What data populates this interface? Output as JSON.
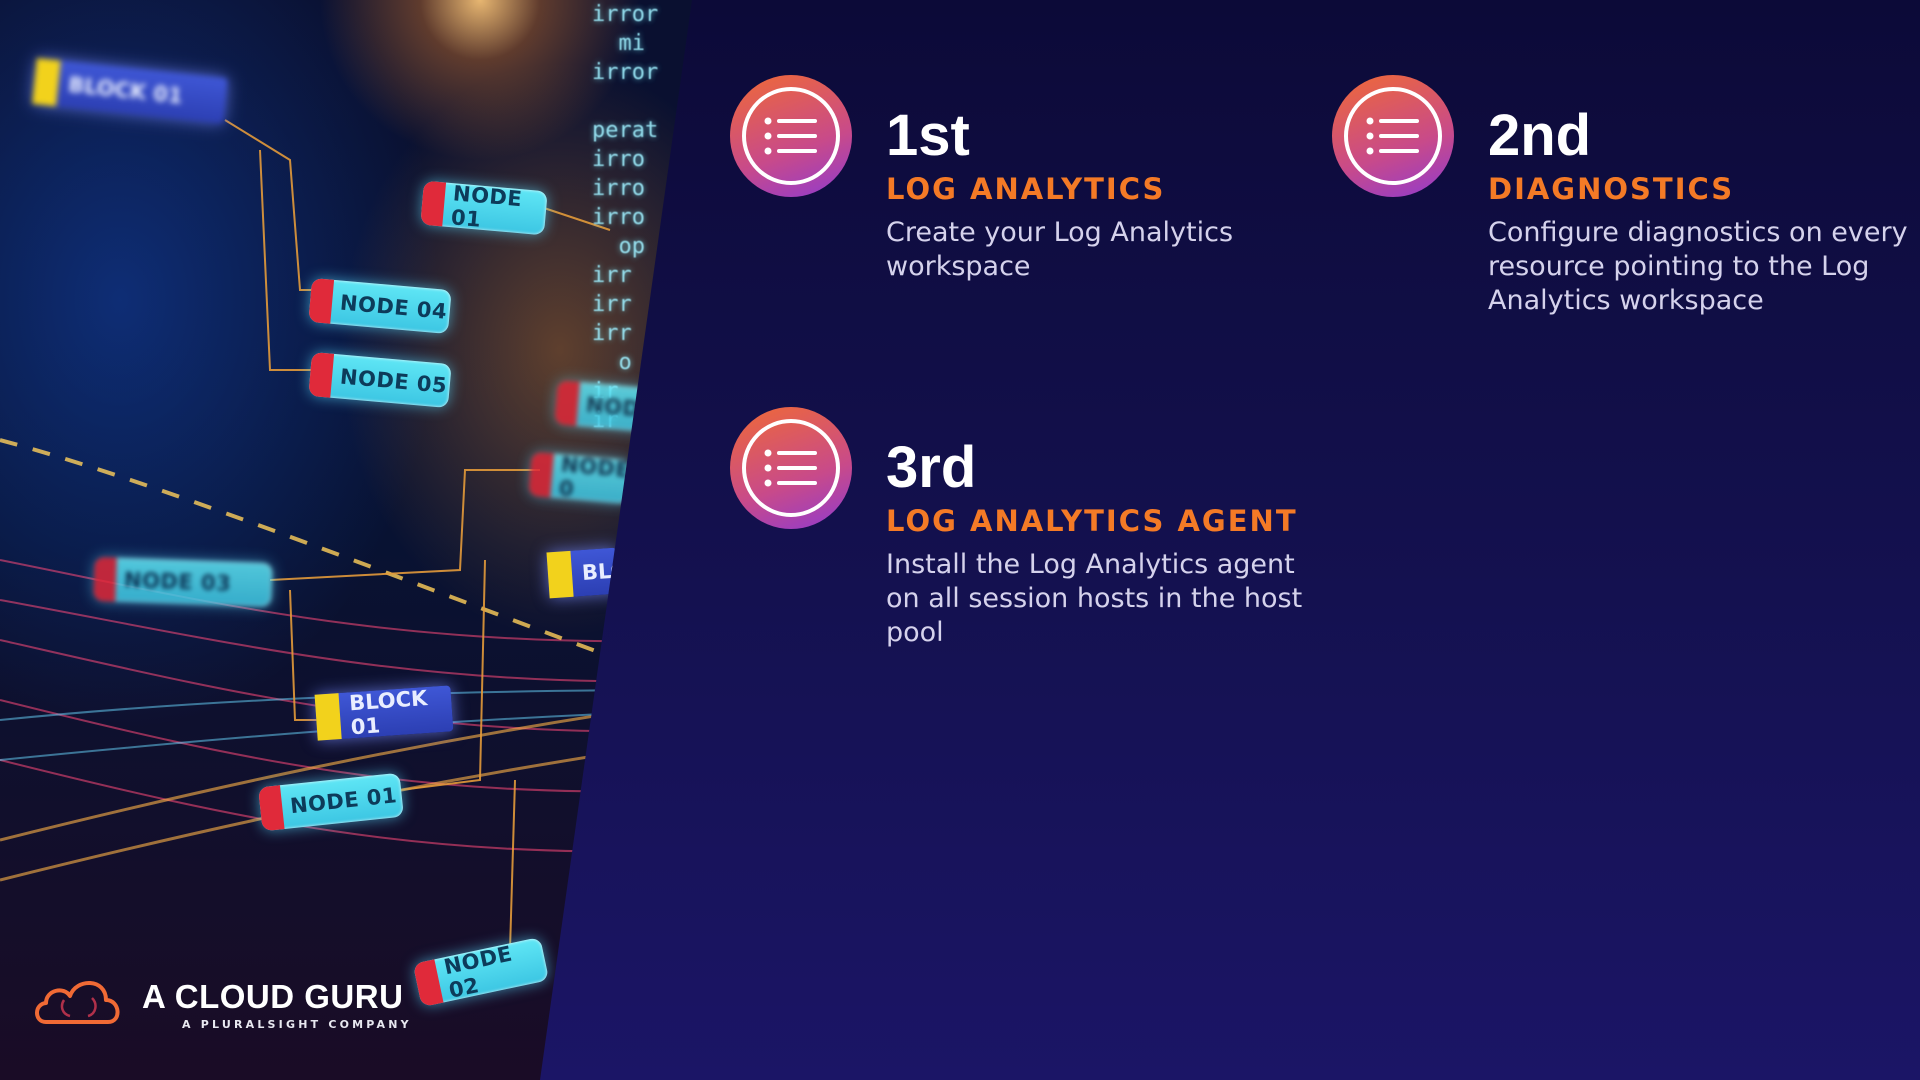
{
  "steps": [
    {
      "title": "1st",
      "subtitle": "LOG ANALYTICS",
      "description": "Create your Log Analytics workspace",
      "icon": "list-icon"
    },
    {
      "title": "2nd",
      "subtitle": "DIAGNOSTICS",
      "description": "Configure diagnostics on every resource pointing to the Log Analytics workspace",
      "icon": "list-icon"
    },
    {
      "title": "3rd",
      "subtitle": "LOG ANALYTICS AGENT",
      "description": "Install the Log Analytics agent on all session hosts in the host pool",
      "icon": "list-icon"
    }
  ],
  "image_labels": {
    "block_top": "BLOCK 01",
    "node_01_top": "NODE 01",
    "node_04": "NODE 04",
    "node_05": "NODE 05",
    "node_03": "NODE 03",
    "block_01": "BLOCK 01",
    "node_01_bottom": "NODE 01",
    "node_02": "NODE 02",
    "node_right_a": "NODE",
    "node_right_b": "NODE 0",
    "block_right": "BLOC",
    "code_lines": "irror\n  mi\nirror\n\nperat\nirro\nirro\nirro\n  op\nirr\nirr\nirr\n  o\nir\nir"
  },
  "logo": {
    "name": "A CLOUD GURU",
    "tagline": "A PLURALSIGHT COMPANY"
  },
  "colors": {
    "accent_orange": "#f47a26",
    "background": "#141150",
    "icon_gradient_start": "#f06a35",
    "icon_gradient_end": "#8f3ad0"
  }
}
